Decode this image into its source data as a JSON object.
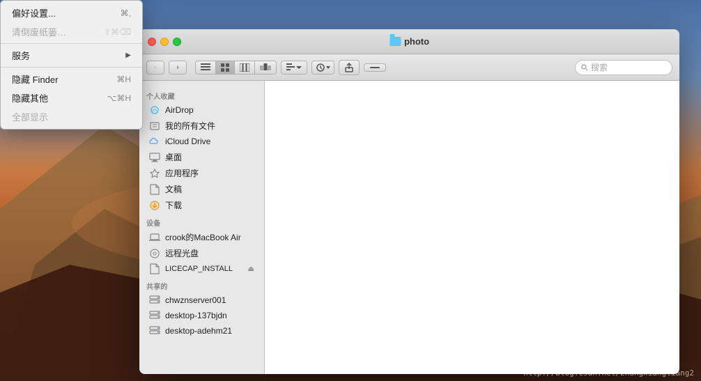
{
  "desktop": {
    "watermark": "http://blog.csdn.net/zhangxiangliang2"
  },
  "finder_window": {
    "title": "photo",
    "traffic_lights": {
      "red": "close",
      "yellow": "minimize",
      "green": "maximize"
    },
    "toolbar": {
      "back_label": "‹",
      "forward_label": "›",
      "view_icons": [
        "≡",
        "⊞",
        "≡",
        "⊟",
        "⊠",
        "⊞"
      ],
      "settings_label": "⚙",
      "share_label": "↑",
      "tag_label": "—",
      "search_placeholder": "搜索"
    },
    "sidebar": {
      "personal_label": "个人收藏",
      "items": [
        {
          "id": "airdrop",
          "label": "AirDrop",
          "icon": "airdrop"
        },
        {
          "id": "all-files",
          "label": "我的所有文件",
          "icon": "files"
        },
        {
          "id": "icloud",
          "label": "iCloud Drive",
          "icon": "icloud"
        },
        {
          "id": "desktop",
          "label": "桌面",
          "icon": "desktop"
        },
        {
          "id": "applications",
          "label": "应用程序",
          "icon": "apps"
        },
        {
          "id": "documents",
          "label": "文稿",
          "icon": "docs"
        },
        {
          "id": "downloads",
          "label": "下载",
          "icon": "downloads"
        }
      ],
      "devices_label": "设备",
      "devices": [
        {
          "id": "macbook",
          "label": "crook的MacBook Air",
          "icon": "macbook"
        },
        {
          "id": "optical",
          "label": "远程光盘",
          "icon": "optical"
        },
        {
          "id": "install",
          "label": "LICECAP_INSTALL",
          "icon": "install"
        }
      ],
      "shared_label": "共享的",
      "shared": [
        {
          "id": "server1",
          "label": "chwznserver001",
          "icon": "server"
        },
        {
          "id": "server2",
          "label": "desktop-137bjdn",
          "icon": "server"
        },
        {
          "id": "server3",
          "label": "desktop-adehm21",
          "icon": "server"
        }
      ]
    }
  },
  "finder_menu": {
    "items": [
      {
        "id": "preferences",
        "label": "偏好设置...",
        "shortcut": "⌘,",
        "disabled": false,
        "submenu": false
      },
      {
        "id": "empty-trash",
        "label": "清倒废纸篓…",
        "shortcut": "⇧⌘⌫",
        "disabled": true,
        "submenu": false
      },
      {
        "id": "sep1",
        "type": "separator"
      },
      {
        "id": "services",
        "label": "服务",
        "shortcut": "",
        "disabled": false,
        "submenu": true
      },
      {
        "id": "sep2",
        "type": "separator"
      },
      {
        "id": "hide-finder",
        "label": "隐藏 Finder",
        "shortcut": "⌘H",
        "disabled": false,
        "submenu": false
      },
      {
        "id": "hide-others",
        "label": "隐藏其他",
        "shortcut": "⌥⌘H",
        "disabled": false,
        "submenu": false
      },
      {
        "id": "show-all",
        "label": "全部显示",
        "shortcut": "",
        "disabled": true,
        "submenu": false
      }
    ]
  }
}
